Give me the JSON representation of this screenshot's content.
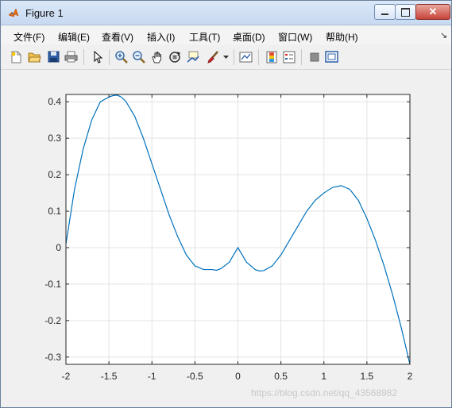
{
  "window": {
    "title": "Figure 1"
  },
  "menu": [
    {
      "label": "文件(F)"
    },
    {
      "label": "编辑(E)"
    },
    {
      "label": "查看(V)"
    },
    {
      "label": "插入(I)"
    },
    {
      "label": "工具(T)"
    },
    {
      "label": "桌面(D)"
    },
    {
      "label": "窗口(W)"
    },
    {
      "label": "帮助(H)"
    }
  ],
  "toolbar": {
    "icons": [
      "new-figure-icon",
      "open-file-icon",
      "save-icon",
      "print-icon",
      "pointer-icon",
      "zoom-in-icon",
      "zoom-out-icon",
      "pan-hand-icon",
      "rotate-3d-icon",
      "data-cursor-icon",
      "brush-icon",
      "brush-dropdown-icon",
      "link-plot-icon",
      "colorbar-icon",
      "legend-icon",
      "hide-plot-tools-icon",
      "show-plot-tools-icon"
    ]
  },
  "watermark": "https://blog.csdn.net/qq_43568982",
  "chart_data": {
    "type": "line",
    "title": "",
    "xlabel": "",
    "ylabel": "",
    "xlim": [
      -2,
      2
    ],
    "ylim": [
      -0.32,
      0.42
    ],
    "xticks": [
      -2,
      -1.5,
      -1,
      -0.5,
      0,
      0.5,
      1,
      1.5,
      2
    ],
    "xtick_labels": [
      "-2",
      "-1.5",
      "-1",
      "-0.5",
      "0",
      "0.5",
      "1",
      "1.5",
      "2"
    ],
    "yticks": [
      -0.3,
      -0.2,
      -0.1,
      0,
      0.1,
      0.2,
      0.3,
      0.4
    ],
    "ytick_labels": [
      "-0.3",
      "-0.2",
      "-0.1",
      "0",
      "0.1",
      "0.2",
      "0.3",
      "0.4"
    ],
    "grid": true,
    "color": "#0072bd",
    "series": [
      {
        "x": [
          -2,
          -1.9,
          -1.8,
          -1.7,
          -1.6,
          -1.5,
          -1.45,
          -1.4,
          -1.35,
          -1.3,
          -1.2,
          -1.1,
          -1.0,
          -0.9,
          -0.8,
          -0.7,
          -0.6,
          -0.5,
          -0.4,
          -0.3,
          -0.25,
          -0.2,
          -0.1,
          0,
          0.1,
          0.2,
          0.25,
          0.3,
          0.4,
          0.5,
          0.6,
          0.7,
          0.8,
          0.9,
          1.0,
          1.1,
          1.2,
          1.3,
          1.4,
          1.5,
          1.6,
          1.7,
          1.8,
          1.9,
          2.0
        ],
        "y": [
          0.01,
          0.16,
          0.27,
          0.35,
          0.4,
          0.413,
          0.417,
          0.418,
          0.412,
          0.4,
          0.36,
          0.3,
          0.23,
          0.16,
          0.09,
          0.03,
          -0.02,
          -0.05,
          -0.06,
          -0.06,
          -0.062,
          -0.058,
          -0.04,
          0,
          -0.04,
          -0.06,
          -0.064,
          -0.063,
          -0.05,
          -0.02,
          0.02,
          0.06,
          0.1,
          0.13,
          0.15,
          0.165,
          0.17,
          0.16,
          0.13,
          0.08,
          0.02,
          -0.05,
          -0.13,
          -0.22,
          -0.32
        ]
      }
    ]
  }
}
